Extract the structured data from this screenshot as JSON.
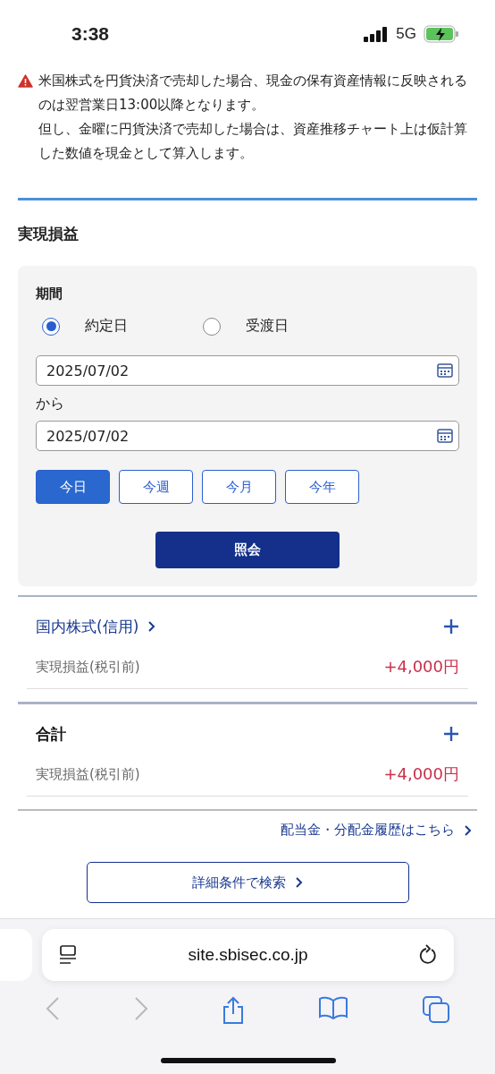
{
  "status_bar": {
    "time": "3:38",
    "network": "5G"
  },
  "notice": {
    "paragraphs": [
      "米国株式を円貨決済で売却した場合、現金の保有資産情報に反映されるのは翌営業日13:00以降となります。",
      "但し、金曜に円貨決済で売却した場合は、資産推移チャート上は仮計算した数値を現金として算入します。"
    ]
  },
  "heading": "実現損益",
  "filter": {
    "label": "期間",
    "date_basis": [
      {
        "label": "約定日",
        "selected": true
      },
      {
        "label": "受渡日",
        "selected": false
      }
    ],
    "from_date": "2025/07/02",
    "separator": "から",
    "to_date": "2025/07/02",
    "periods": [
      {
        "label": "今日",
        "selected": true
      },
      {
        "label": "今週",
        "selected": false
      },
      {
        "label": "今月",
        "selected": false
      },
      {
        "label": "今年",
        "selected": false
      }
    ],
    "submit": "照会"
  },
  "sections": [
    {
      "title": "国内株式(信用)",
      "kind": "link",
      "row_label": "実現損益(税引前)",
      "value": "+4,000円"
    },
    {
      "title": "合計",
      "kind": "plain",
      "row_label": "実現損益(税引前)",
      "value": "+4,000円"
    }
  ],
  "history_link": "配当金・分配金履歴はこちら",
  "search_button": "詳細条件で検索",
  "browser": {
    "url": "site.sbisec.co.jp",
    "back_disabled": true,
    "forward_disabled": true
  }
}
